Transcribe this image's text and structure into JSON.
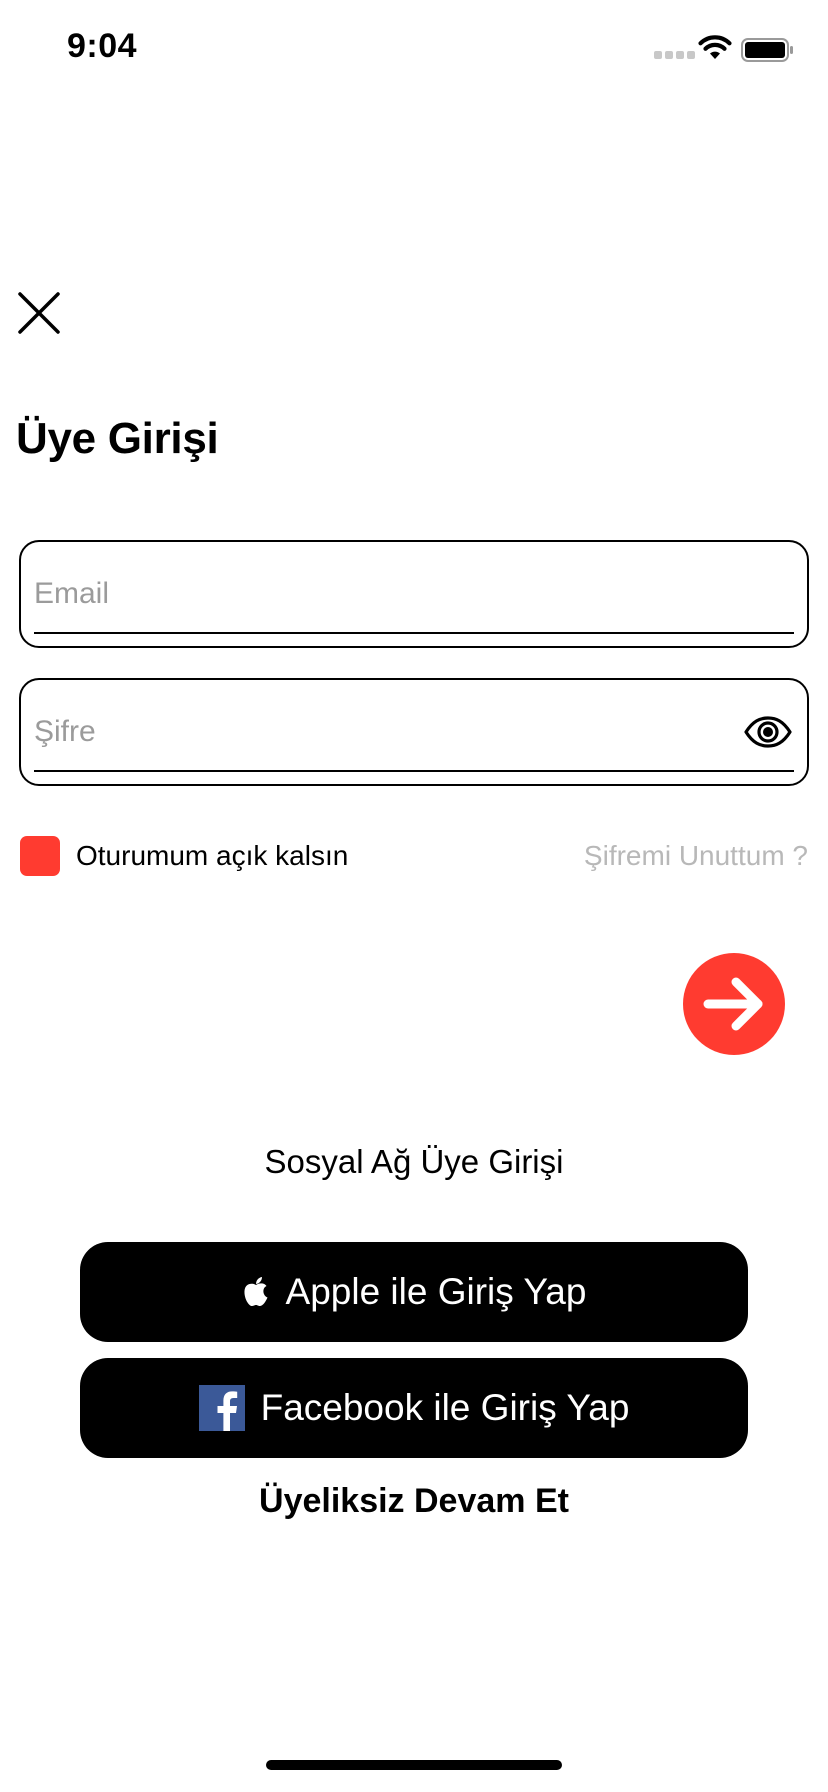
{
  "status_bar": {
    "time": "9:04"
  },
  "header": {
    "close_icon": "close-icon",
    "title": "Üye Girişi"
  },
  "form": {
    "email": {
      "value": "",
      "placeholder": "Email"
    },
    "password": {
      "value": "",
      "placeholder": "Şifre",
      "toggle_icon": "eye-icon"
    },
    "remember_me": {
      "label": "Oturumum açık kalsın",
      "checked": true,
      "color": "#ff3b30"
    },
    "forgot_password": "Şifremi Unuttum ?",
    "submit_icon": "arrow-right-icon"
  },
  "social": {
    "heading": "Sosyal Ağ Üye Girişi",
    "apple_label": "Apple ile Giriş Yap",
    "facebook_label": "Facebook ile Giriş Yap"
  },
  "guest_label": "Üyeliksiz Devam Et",
  "colors": {
    "accent": "#ff3b30",
    "facebook": "#3b5998",
    "placeholder": "#9b9b9b",
    "muted_link": "#b8b8b8"
  }
}
